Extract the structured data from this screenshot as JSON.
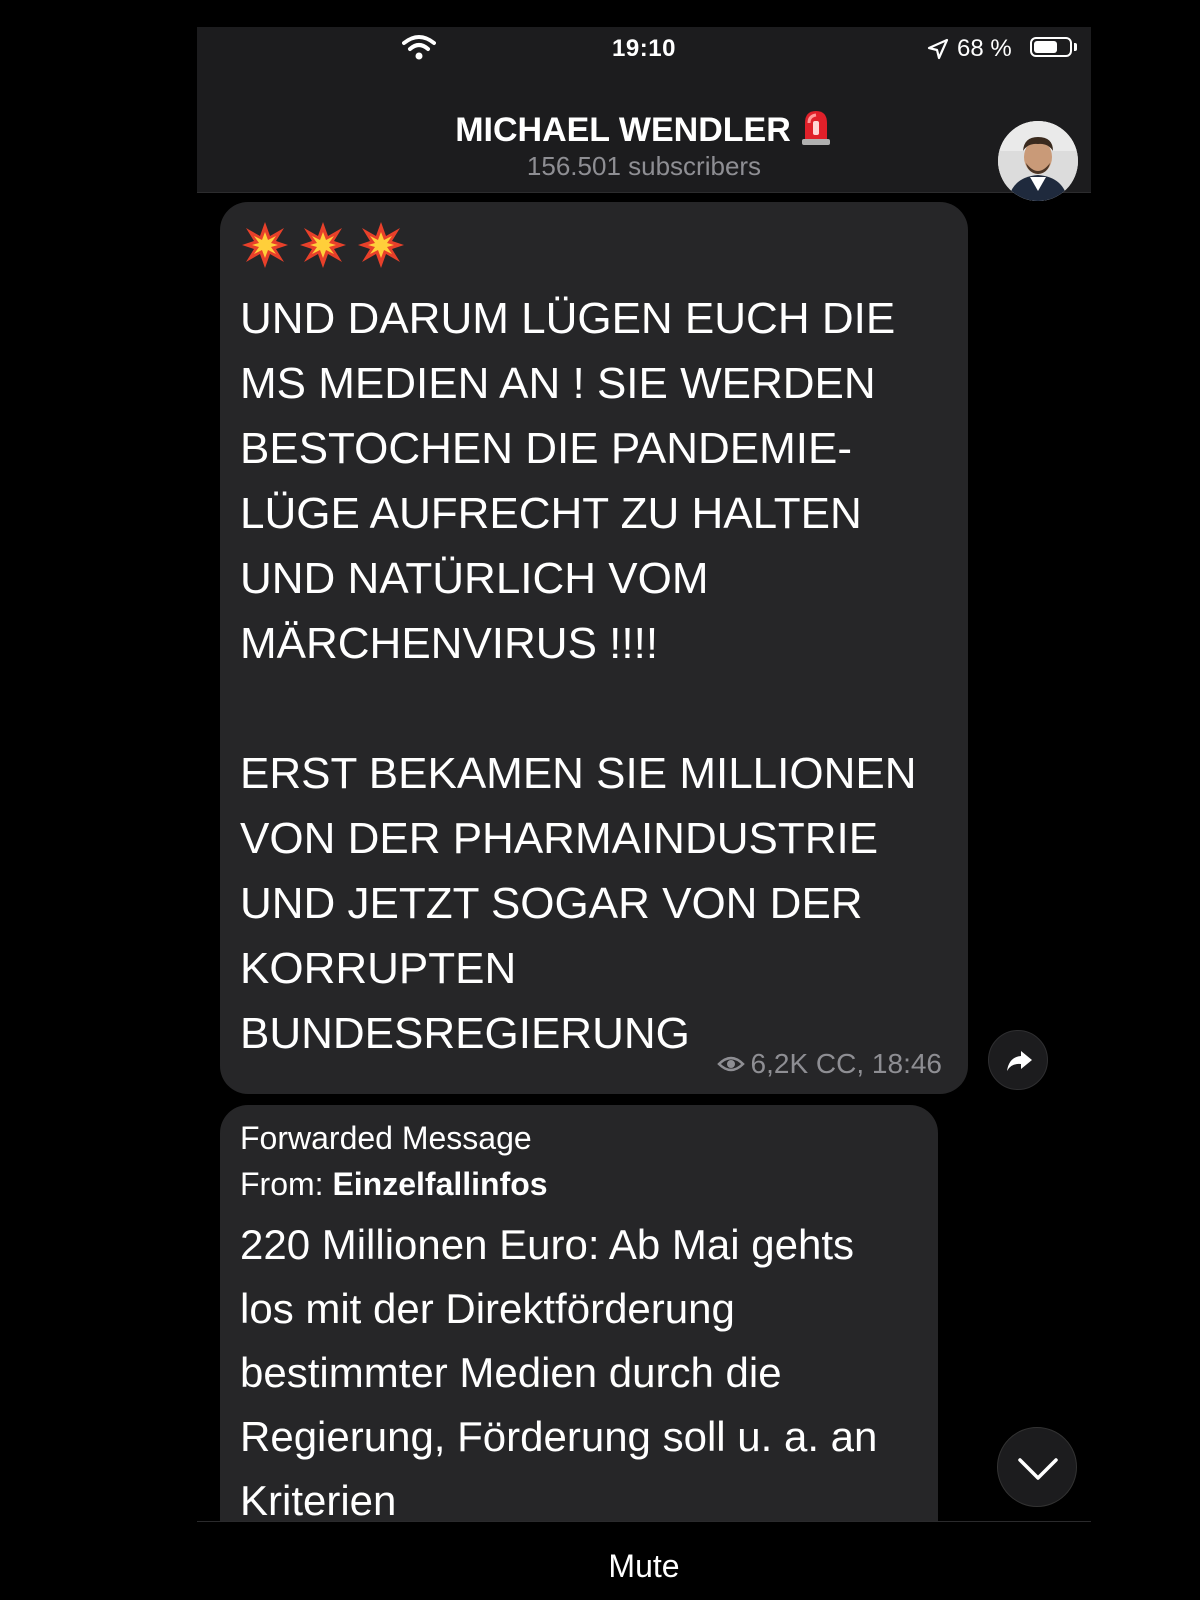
{
  "status_bar": {
    "time": "19:10",
    "battery_percent_label": "68 %",
    "battery_level": 0.68
  },
  "header": {
    "channel_name": "MICHAEL WENDLER",
    "subscribers": "156.501 subscribers"
  },
  "messages": [
    {
      "emojis": [
        "collision",
        "collision",
        "collision"
      ],
      "text": "UND DARUM LÜGEN EUCH DIE MS MEDIEN AN ! SIE WERDEN BESTOCHEN DIE PANDEMIE-LÜGE AUFRECHT ZU HALTEN UND NATÜRLICH VOM MÄRCHENVIRUS !!!!\n\nERST BEKAMEN SIE MILLIONEN VON DER PHARMAINDUSTRIE UND JETZT SOGAR VON DER KORRUPTEN BUNDESREGIERUNG",
      "views": "6,2K CC, 18:46"
    },
    {
      "forwarded_label": "Forwarded Message",
      "from_prefix": "From: ",
      "from_source": "Einzelfallinfos",
      "text": "220 Millionen Euro: Ab Mai gehts los mit der Direktförderung bestimmter Medien durch die Regierung, Förderung soll u. a. an Kriterien"
    }
  ],
  "bottom_bar": {
    "mute_label": "Mute"
  },
  "colors": {
    "background": "#000000",
    "bar": "#1c1c1e",
    "bubble": "#262628",
    "secondary_text": "#8e8e93",
    "siren_red": "#e0202a"
  },
  "icons": [
    "wifi-icon",
    "location-arrow-icon",
    "battery-icon",
    "siren-icon",
    "collision-icon",
    "eye-icon",
    "share-icon",
    "chevron-down-icon"
  ]
}
